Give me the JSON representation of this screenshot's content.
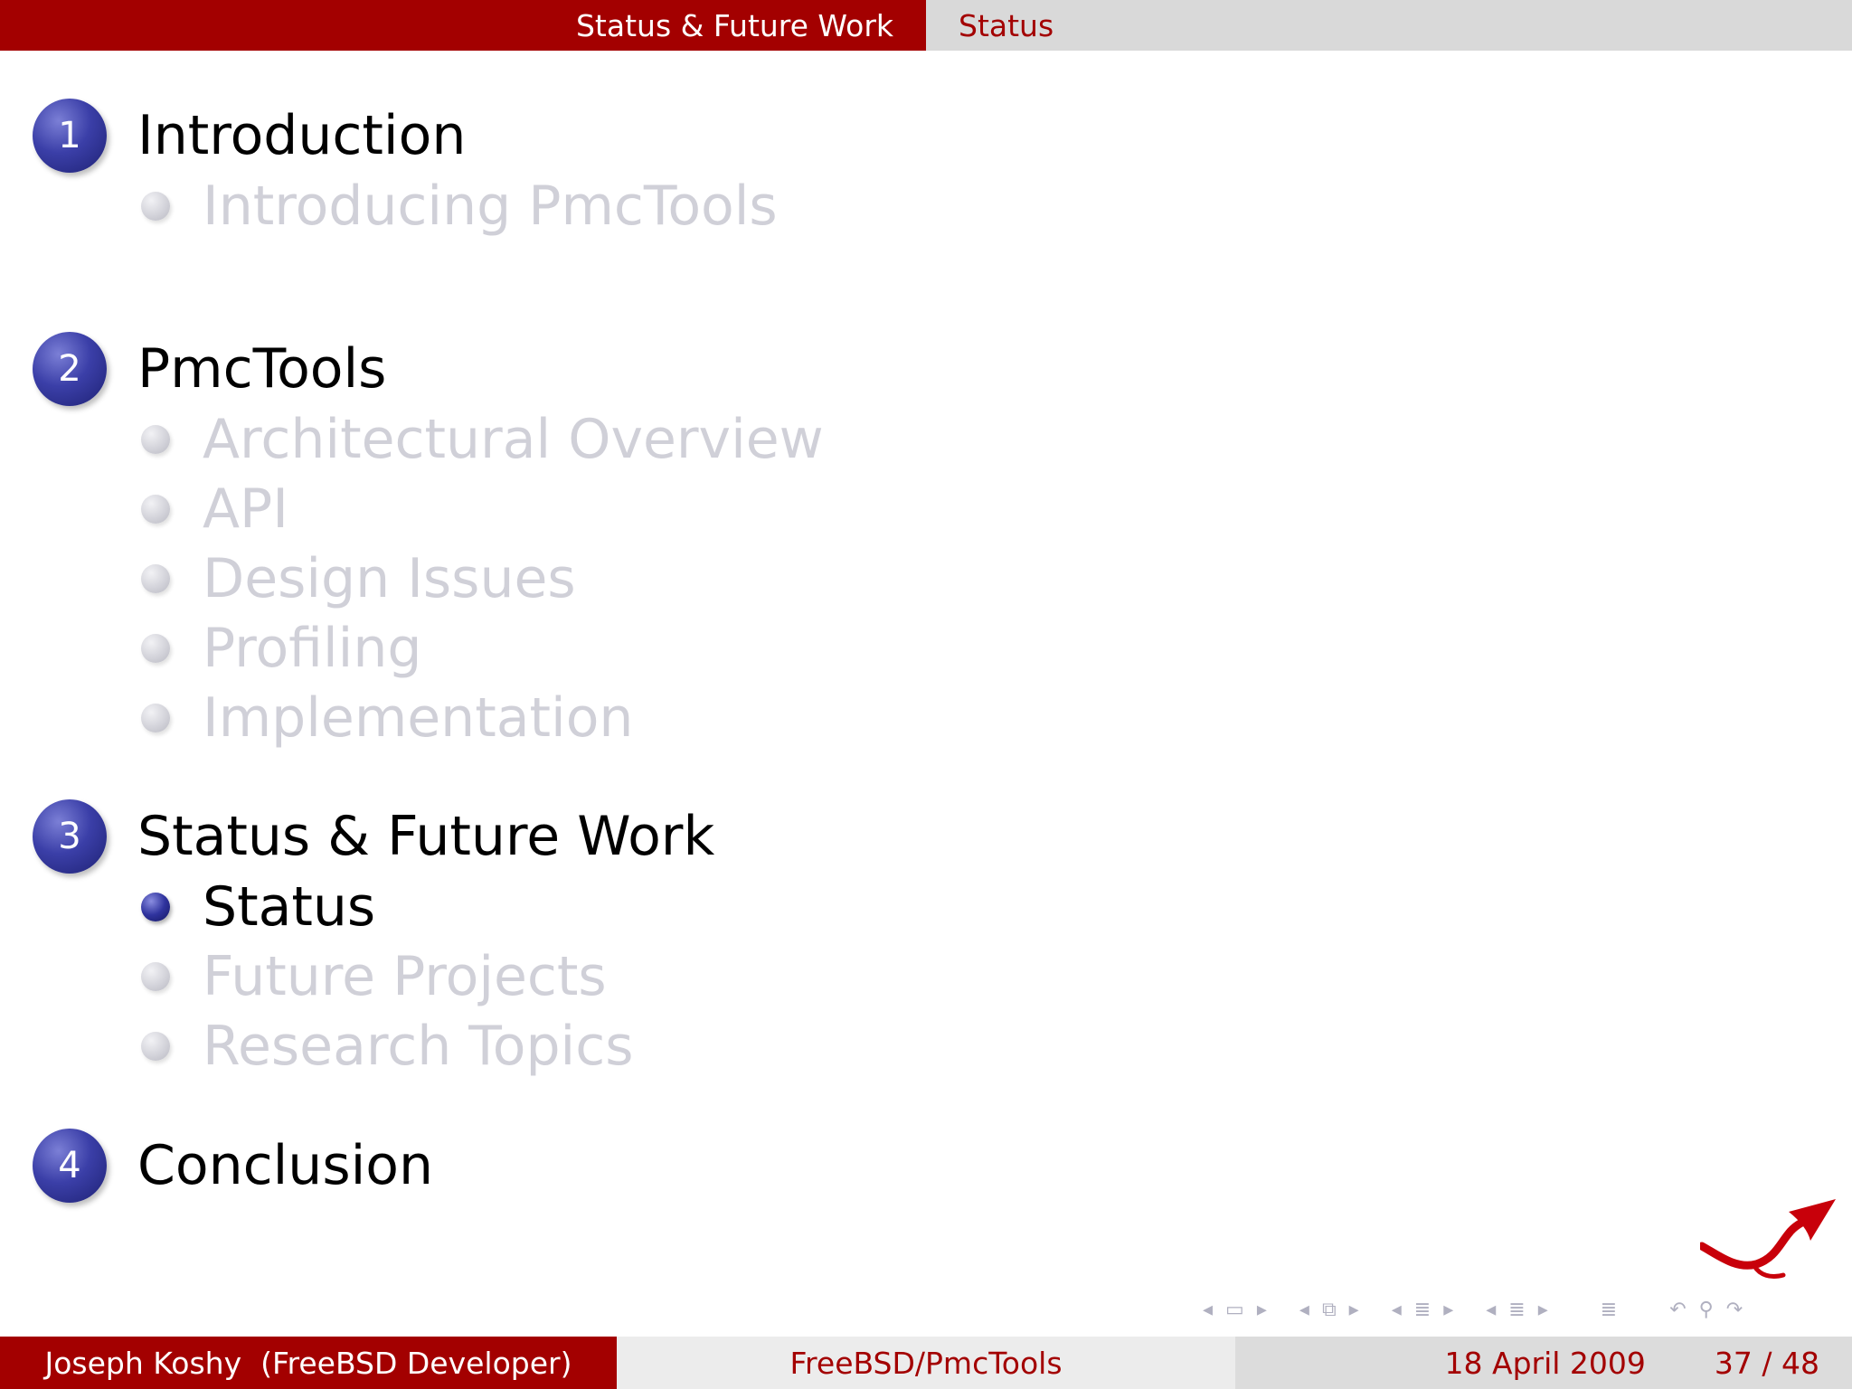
{
  "header": {
    "section": "Status & Future Work",
    "subsection": "Status"
  },
  "outline": [
    {
      "number": "1",
      "title": "Introduction",
      "items": [
        {
          "label": "Introducing PmcTools",
          "active": false
        }
      ]
    },
    {
      "number": "2",
      "title": "PmcTools",
      "items": [
        {
          "label": "Architectural Overview",
          "active": false
        },
        {
          "label": "API",
          "active": false
        },
        {
          "label": "Design Issues",
          "active": false
        },
        {
          "label": "Profiling",
          "active": false
        },
        {
          "label": "Implementation",
          "active": false
        }
      ]
    },
    {
      "number": "3",
      "title": "Status & Future Work",
      "items": [
        {
          "label": "Status",
          "active": true
        },
        {
          "label": "Future Projects",
          "active": false
        },
        {
          "label": "Research Topics",
          "active": false
        }
      ]
    },
    {
      "number": "4",
      "title": "Conclusion",
      "items": []
    }
  ],
  "footer": {
    "author": "Joseph Koshy  (FreeBSD Developer)",
    "title": "FreeBSD/PmcTools",
    "date": "18 April 2009",
    "page": "37 / 48"
  },
  "colors": {
    "accent": "#a30000",
    "header_right_bg": "#d9d9d9",
    "inactive_text": "#d0d0d8",
    "ball": "#3b3fa8"
  },
  "icons": {
    "logo": "freebsd-daemon-tail-icon",
    "nav": [
      "nav-frame-icon",
      "nav-subsection-icon",
      "nav-section-icon",
      "nav-document-icon",
      "nav-search-icon"
    ]
  }
}
